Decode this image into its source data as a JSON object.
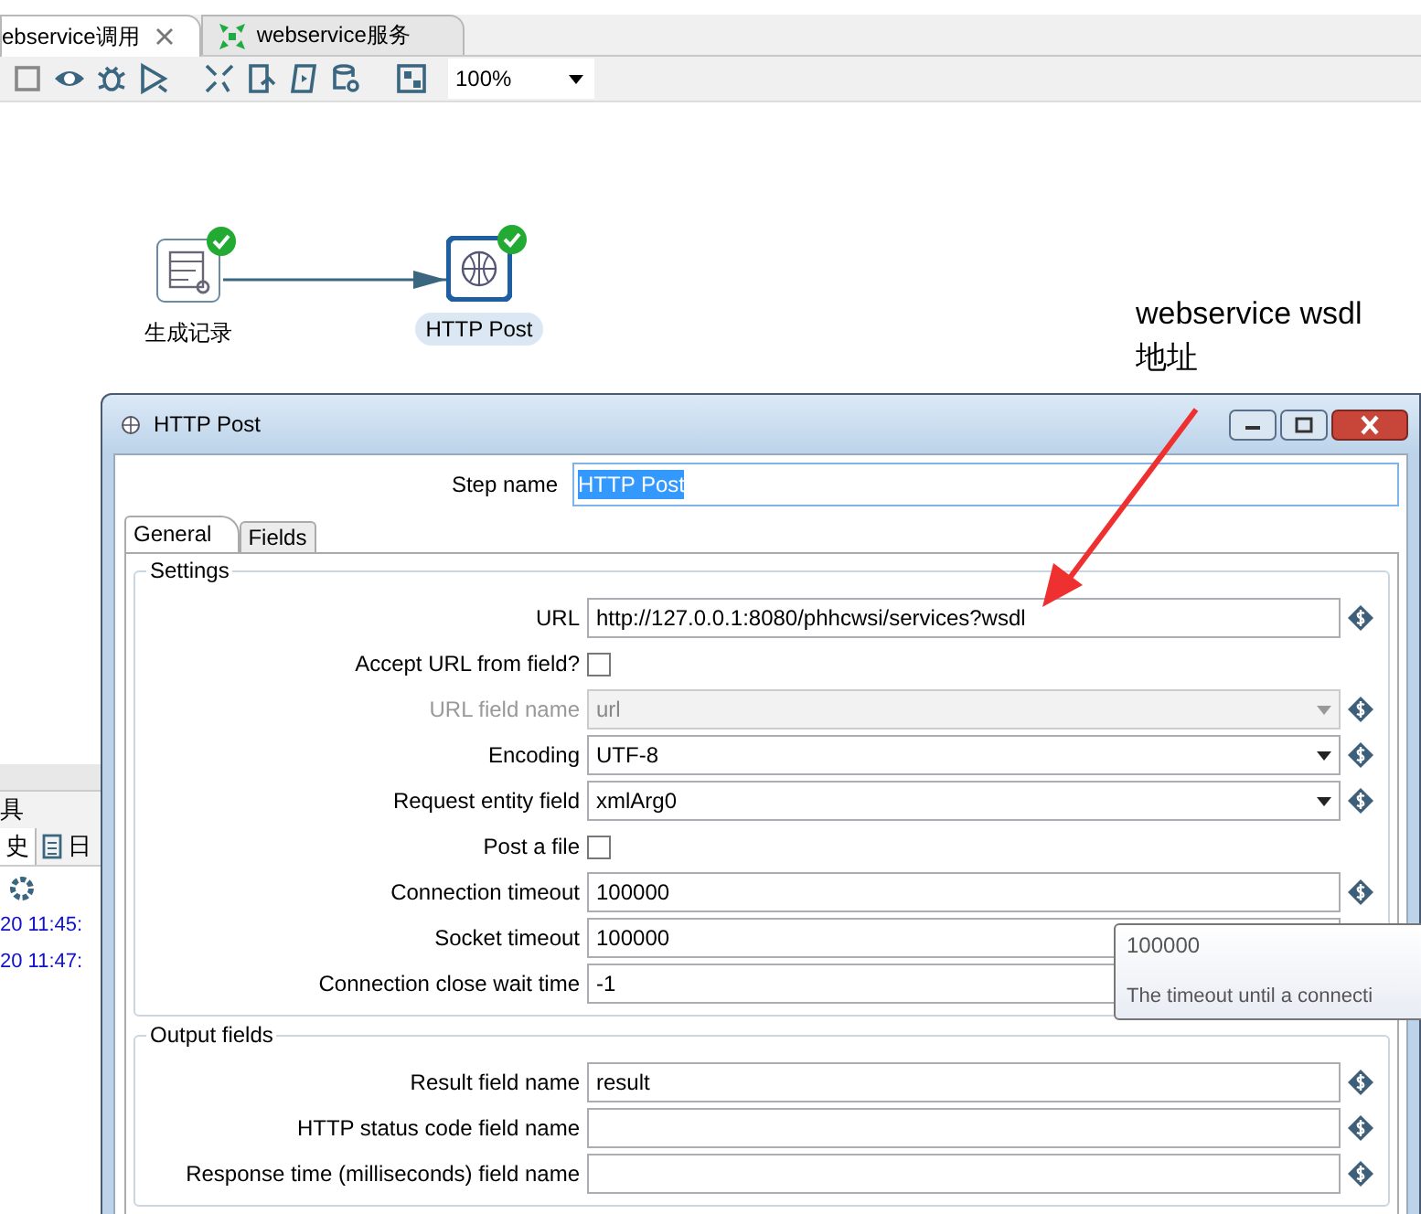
{
  "editor_tabs": [
    {
      "label": "ebservice调用",
      "selected": true,
      "closable": true,
      "kind": "plain"
    },
    {
      "label": "webservice服务",
      "selected": false,
      "closable": false,
      "kind": "job"
    }
  ],
  "toolbar": {
    "zoom": "100%"
  },
  "canvas": {
    "steps": [
      {
        "label": "生成记录",
        "kind": "generator",
        "selected": false
      },
      {
        "label": "HTTP Post",
        "kind": "http",
        "selected": true
      }
    ]
  },
  "bottom_panel": {
    "title": "具",
    "tabs": [
      {
        "label": "史",
        "selected": true
      },
      {
        "label": "日",
        "selected": false
      }
    ],
    "log_lines": [
      "20 11:45:",
      "20 11:47:"
    ]
  },
  "annotation": {
    "lines": [
      "webservice wsdl",
      "地址"
    ]
  },
  "dialog": {
    "title": "HTTP Post",
    "step_name_label": "Step name",
    "step_name": "HTTP Post",
    "tabs": [
      {
        "label": "General",
        "selected": true
      },
      {
        "label": "Fields",
        "selected": false
      }
    ],
    "groups": [
      {
        "title": "Settings",
        "rows": [
          {
            "label": "URL",
            "kind": "text",
            "value": "http://127.0.0.1:8080/phhcwsi/services?wsdl",
            "disabled": false,
            "variable": true
          },
          {
            "label": "Accept URL from field?",
            "kind": "checkbox",
            "checked": false,
            "disabled": false,
            "variable": false
          },
          {
            "label": "URL field name",
            "kind": "dropdown",
            "value": "url",
            "disabled": true,
            "variable": true
          },
          {
            "label": "Encoding",
            "kind": "dropdown",
            "value": "UTF-8",
            "disabled": false,
            "variable": true
          },
          {
            "label": "Request entity field",
            "kind": "dropdown",
            "value": "xmlArg0",
            "disabled": false,
            "variable": true
          },
          {
            "label": "Post a file",
            "kind": "checkbox",
            "checked": false,
            "disabled": false,
            "variable": false
          },
          {
            "label": "Connection timeout",
            "kind": "text",
            "value": "100000",
            "disabled": false,
            "variable": true
          },
          {
            "label": "Socket timeout",
            "kind": "text",
            "value": "100000",
            "disabled": false
          },
          {
            "label": "Connection close wait time",
            "kind": "text",
            "value": "-1",
            "disabled": false
          }
        ]
      },
      {
        "title": "Output fields",
        "rows": [
          {
            "label": "Result field name",
            "kind": "text",
            "value": "result",
            "disabled": false,
            "variable": true
          },
          {
            "label": "HTTP status code field name",
            "kind": "text",
            "disabled": false,
            "variable": true
          },
          {
            "label": "Response time (milliseconds) field name",
            "kind": "text",
            "disabled": false,
            "variable": true
          }
        ]
      }
    ],
    "tooltip": {
      "value": "100000",
      "text": "The timeout until a connecti"
    }
  }
}
